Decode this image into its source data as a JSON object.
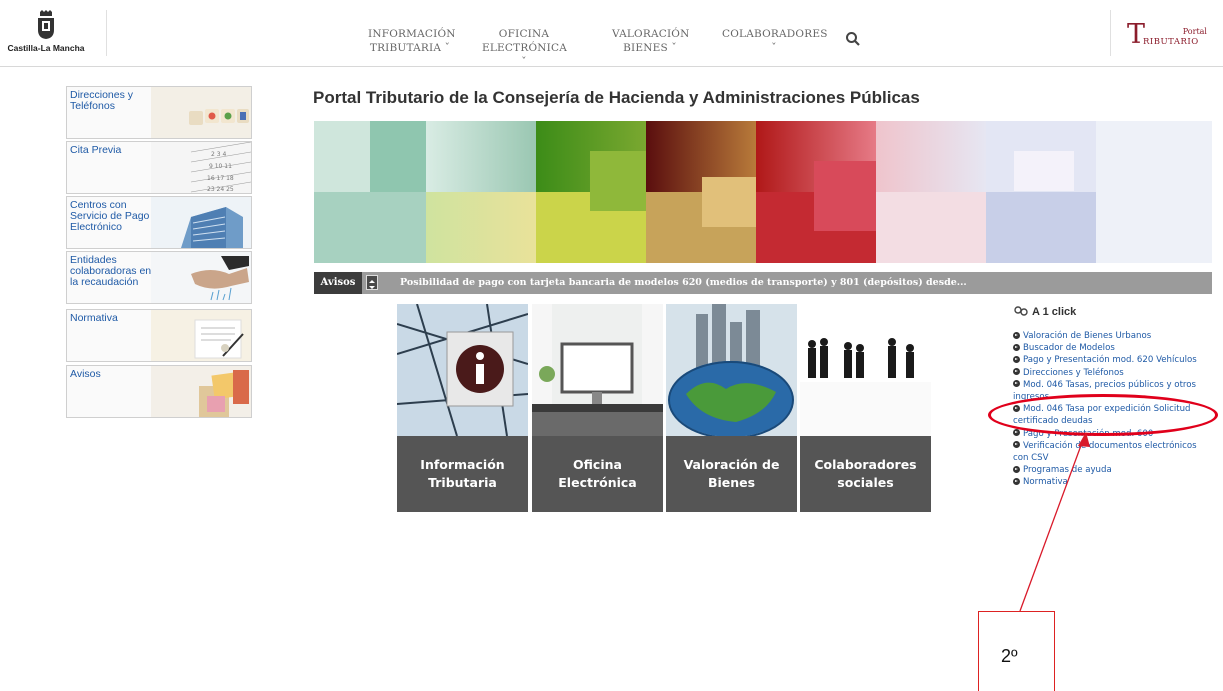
{
  "header": {
    "logo_text": "Castilla-La Mancha",
    "nav": [
      {
        "line1": "INFORMACIÓN",
        "line2": "TRIBUTARIA ˇ"
      },
      {
        "line1": "OFICINA",
        "line2": "ELECTRÓNICA ˇ"
      },
      {
        "line1": "VALORACIÓN",
        "line2": "BIENES ˇ"
      },
      {
        "line1": "COLABORADORES",
        "line2": "ˇ"
      }
    ],
    "portal_logo": {
      "big": "T",
      "small_top": "Portal",
      "small_bottom": "RIBUTARIO"
    }
  },
  "sidebar": [
    {
      "label": "Direcciones y Teléfonos"
    },
    {
      "label": "Cita Previa"
    },
    {
      "label": "Centros con Servicio de Pago Electrónico"
    },
    {
      "label": "Entidades colaboradoras en la recaudación"
    },
    {
      "label": "Normativa"
    },
    {
      "label": "Avisos"
    }
  ],
  "main": {
    "title": "Portal Tributario de la Consejería de Hacienda y Administraciones Públicas",
    "avisos_label": "Avisos",
    "avisos_text": "Posibilidad de pago con tarjeta bancaria de modelos 620 (medios de transporte) y 801 (depósitos) desde...",
    "tiles": [
      {
        "line1": "Información",
        "line2": "Tributaria"
      },
      {
        "line1": "Oficina",
        "line2": "Electrónica"
      },
      {
        "line1": "Valoración de",
        "line2": "Bienes"
      },
      {
        "line1": "Colaboradores",
        "line2": "sociales"
      }
    ]
  },
  "quick_links": {
    "title": "A 1 click",
    "items": [
      "Valoración de Bienes Urbanos",
      "Buscador de Modelos",
      "Pago y Presentación mod. 620 Vehículos",
      "Direcciones y Teléfonos",
      "Mod. 046 Tasas, precios públicos y otros ingresos",
      "Mod. 046 Tasa por expedición Solicitud certificado deudas",
      "Pago y Presentación mod. 600",
      "Verificación de documentos electrónicos con CSV",
      "Programas de ayuda",
      "Normativa"
    ]
  },
  "annotation": {
    "label": "2º",
    "color": "#e0001b"
  }
}
